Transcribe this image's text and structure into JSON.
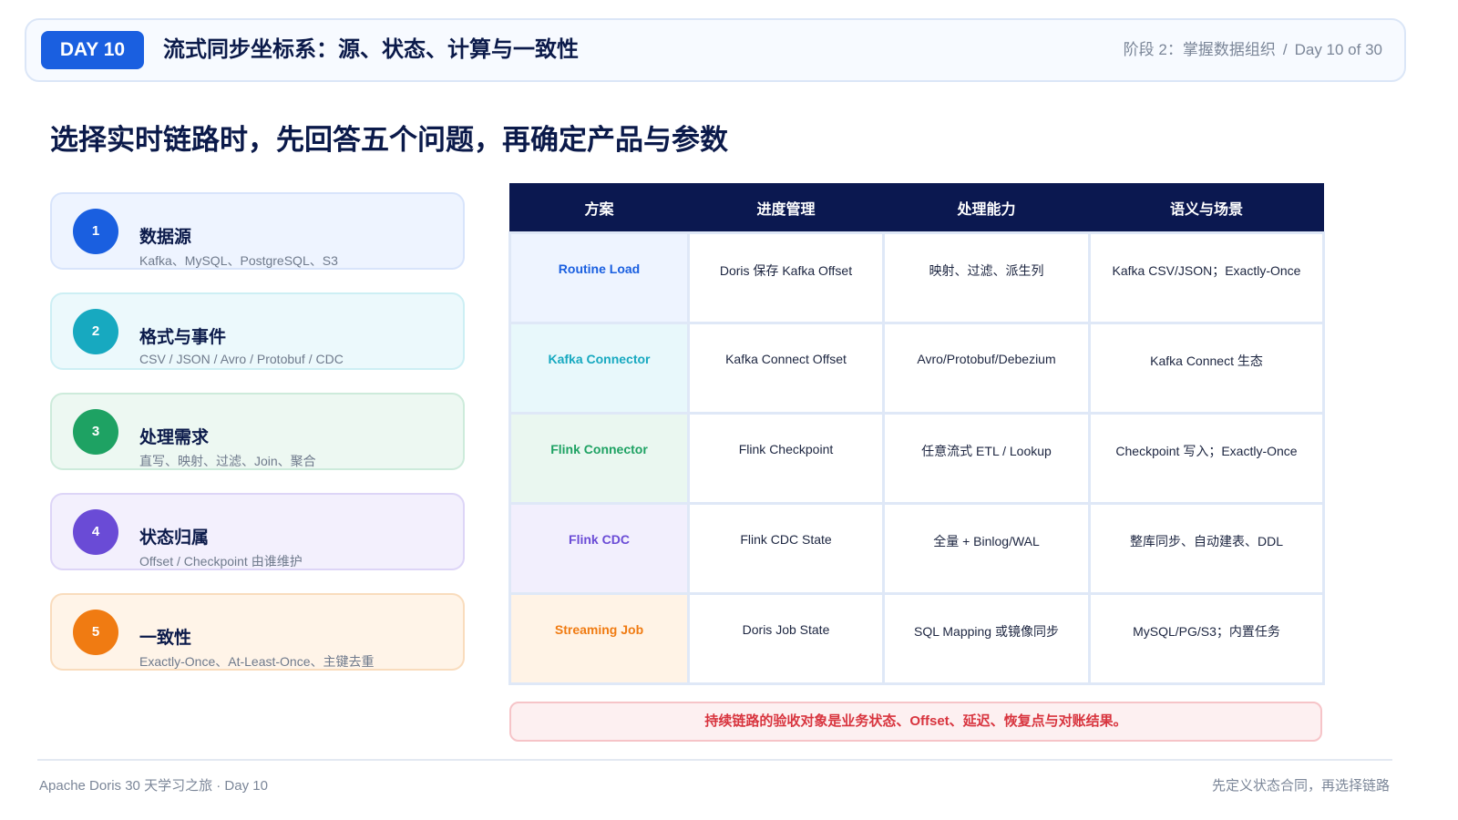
{
  "header": {
    "day_label": "DAY 10",
    "title": "流式同步坐标系：源、状态、计算与一致性",
    "phase": "阶段 2：掌握数据组织",
    "separator": "/",
    "progress": "Day 10 of 30"
  },
  "main_title": "选择实时链路时，先回答五个问题，再确定产品与参数",
  "steps": [
    {
      "num": "1",
      "title": "数据源",
      "desc": "Kafka、MySQL、PostgreSQL、S3",
      "color": "#1a5fe0",
      "bg": "#eef4ff",
      "border": "#d8e4fb"
    },
    {
      "num": "2",
      "title": "格式与事件",
      "desc": "CSV / JSON / Avro / Protobuf / CDC",
      "color": "#17a9c0",
      "bg": "#ecf9fc",
      "border": "#cdeff4"
    },
    {
      "num": "3",
      "title": "处理需求",
      "desc": "直写、映射、过滤、Join、聚合",
      "color": "#1ea263",
      "bg": "#edf8f2",
      "border": "#cdebdb"
    },
    {
      "num": "4",
      "title": "状态归属",
      "desc": "Offset / Checkpoint 由谁维护",
      "color": "#6a4bd6",
      "bg": "#f3f0fd",
      "border": "#ddd5f7"
    },
    {
      "num": "5",
      "title": "一致性",
      "desc": "Exactly-Once、At-Least-Once、主键去重",
      "color": "#f07b12",
      "bg": "#fff4e8",
      "border": "#f9dcbd"
    }
  ],
  "table": {
    "headers": [
      "方案",
      "进度管理",
      "处理能力",
      "语义与场景"
    ],
    "rows": [
      {
        "name": "Routine Load",
        "color": "#1a5fe0",
        "bg": "#eef4ff",
        "cells": [
          "Doris 保存 Kafka Offset",
          "映射、过滤、派生列",
          "Kafka CSV/JSON；Exactly-Once"
        ]
      },
      {
        "name": "Kafka Connector",
        "color": "#17a9c0",
        "bg": "#e8f8fb",
        "cells": [
          "Kafka Connect Offset",
          "Avro/Protobuf/Debezium",
          "Kafka Connect 生态"
        ]
      },
      {
        "name": "Flink Connector",
        "color": "#1ea263",
        "bg": "#eaf7f0",
        "cells": [
          "Flink Checkpoint",
          "任意流式 ETL / Lookup",
          "Checkpoint 写入；Exactly-Once"
        ]
      },
      {
        "name": "Flink CDC",
        "color": "#6a4bd6",
        "bg": "#f2effd",
        "cells": [
          "Flink CDC State",
          "全量 + Binlog/WAL",
          "整库同步、自动建表、DDL"
        ]
      },
      {
        "name": "Streaming Job",
        "color": "#f07b12",
        "bg": "#fff3e6",
        "cells": [
          "Doris Job State",
          "SQL Mapping 或镜像同步",
          "MySQL/PG/S3；内置任务"
        ]
      }
    ]
  },
  "note": "持续链路的验收对象是业务状态、Offset、延迟、恢复点与对账结果。",
  "footer": {
    "left": "Apache Doris 30 天学习之旅 · Day 10",
    "right": "先定义状态合同，再选择链路"
  }
}
